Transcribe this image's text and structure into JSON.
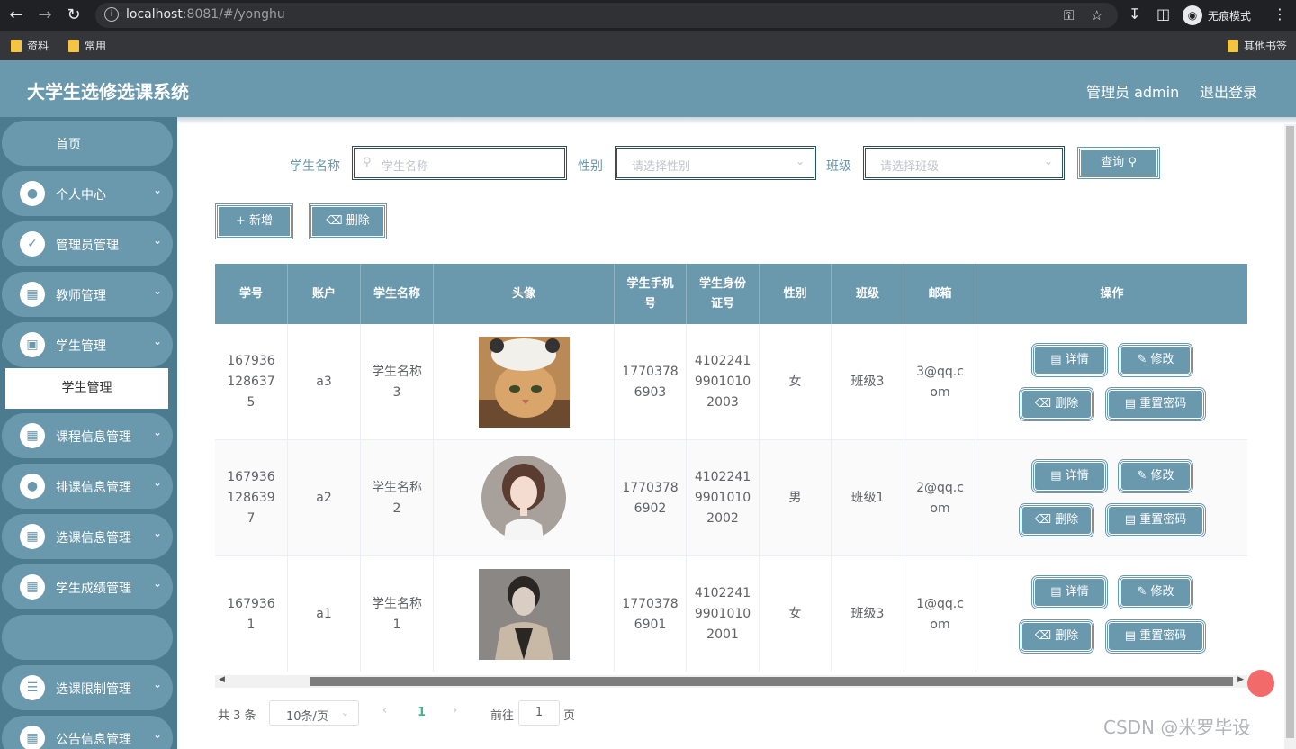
{
  "browser": {
    "url_host": "localhost",
    "url_rest": ":8081/#/yonghu",
    "incognito_label": "无痕模式",
    "bookmarks": [
      "资料",
      "常用"
    ],
    "other_bookmarks": "其他书签"
  },
  "header": {
    "title": "大学生选修选课系统",
    "user": "管理员 admin",
    "logout": "退出登录"
  },
  "sidebar": {
    "home": "首页",
    "items": [
      {
        "label": "个人中心",
        "icon": "user-icon"
      },
      {
        "label": "管理员管理",
        "icon": "clipboard-icon"
      },
      {
        "label": "教师管理",
        "icon": "grid-icon"
      },
      {
        "label": "学生管理",
        "icon": "briefcase-icon"
      },
      {
        "label": "课程信息管理",
        "icon": "grid-icon"
      },
      {
        "label": "排课信息管理",
        "icon": "user-icon"
      },
      {
        "label": "选课信息管理",
        "icon": "grid-icon"
      },
      {
        "label": "学生成绩管理",
        "icon": "grid-icon"
      },
      {
        "label": "选课限制管理",
        "icon": "list-icon"
      },
      {
        "label": "公告信息管理",
        "icon": "grid-icon"
      }
    ],
    "active_sub": "学生管理"
  },
  "search": {
    "name_label": "学生名称",
    "name_placeholder": "学生名称",
    "gender_label": "性别",
    "gender_placeholder": "请选择性别",
    "class_label": "班级",
    "class_placeholder": "请选择班级",
    "query_button": "查询"
  },
  "actions": {
    "add": "新增",
    "delete": "删除"
  },
  "table": {
    "headers": [
      "学号",
      "账户",
      "学生名称",
      "头像",
      "学生手机号",
      "学生身份证号",
      "性别",
      "班级",
      "邮箱",
      "操作"
    ],
    "rows": [
      {
        "id": "1679361286375",
        "account": "a3",
        "name": "学生名称3",
        "avatar": "cat-avatar",
        "phone": "17703786903",
        "idcard": "410224199010102003",
        "gender": "女",
        "class": "班级3",
        "email": "3@qq.com"
      },
      {
        "id": "1679361286397",
        "account": "a2",
        "name": "学生名称2",
        "avatar": "girl-avatar",
        "phone": "17703786902",
        "idcard": "410224199010102002",
        "gender": "男",
        "class": "班级1",
        "email": "2@qq.com"
      },
      {
        "id": "1679361",
        "account": "a1",
        "name": "学生名称1",
        "avatar": "man-avatar",
        "phone": "17703786901",
        "idcard": "410224199010102001",
        "gender": "女",
        "class": "班级3",
        "email": "1@qq.com"
      }
    ],
    "op_labels": {
      "detail": "详情",
      "edit": "修改",
      "delete": "删除",
      "reset": "重置密码"
    }
  },
  "pagination": {
    "total": "共 3 条",
    "page_size": "10条/页",
    "current_page": "1",
    "goto_label": "前往",
    "goto_value": "1",
    "page_suffix": "页"
  },
  "watermark": "CSDN @米罗毕设",
  "colors": {
    "primary": "#6a98ad",
    "sidebar": "#4c7a8f",
    "chrome": "#202124"
  }
}
